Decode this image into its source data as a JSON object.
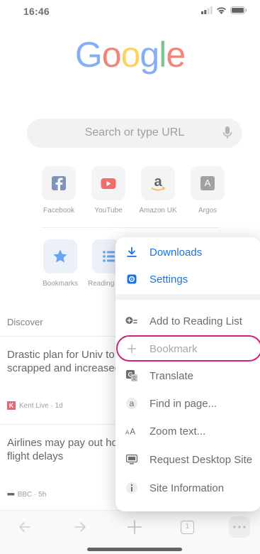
{
  "status": {
    "time": "16:46"
  },
  "logo": {
    "letters": [
      "G",
      "o",
      "o",
      "g",
      "l",
      "e"
    ],
    "colors": [
      "#4285F4",
      "#EA4335",
      "#FBBC05",
      "#4285F4",
      "#34A853",
      "#EA4335"
    ]
  },
  "search": {
    "placeholder": "Search or type URL"
  },
  "tiles_row1": [
    {
      "label": "Facebook",
      "icon": "facebook-icon"
    },
    {
      "label": "YouTube",
      "icon": "youtube-icon"
    },
    {
      "label": "Amazon UK",
      "icon": "amazon-icon"
    },
    {
      "label": "Argos",
      "icon": "argos-icon",
      "letter": "A"
    }
  ],
  "tiles_row2": [
    {
      "label": "Bookmarks",
      "icon": "star-icon"
    },
    {
      "label": "Reading",
      "icon": "list-icon"
    }
  ],
  "discover": {
    "heading": "Discover"
  },
  "articles": [
    {
      "title": "Drastic plan for Univ to be scrapped and increased",
      "source": "Kent Live · 1d",
      "source_badge": "K"
    },
    {
      "title": "Airlines may pay out hour UK flight delays",
      "source": "BBC · 5h",
      "source_badge": "■■■"
    }
  ],
  "menu": {
    "items": [
      {
        "label": "Downloads",
        "icon": "download-icon",
        "style": "blue"
      },
      {
        "label": "Settings",
        "icon": "gear-icon",
        "style": "blue"
      },
      {
        "label": "Add to Reading List",
        "icon": "add-reading-list-icon",
        "style": "gray"
      },
      {
        "label": "Bookmark",
        "icon": "plus-icon",
        "style": "faded"
      },
      {
        "label": "Translate",
        "icon": "translate-icon",
        "style": "gray"
      },
      {
        "label": "Find in page...",
        "icon": "find-icon",
        "style": "gray"
      },
      {
        "label": "Zoom text...",
        "icon": "zoom-text-icon",
        "style": "gray"
      },
      {
        "label": "Request Desktop Site",
        "icon": "desktop-icon",
        "style": "gray"
      },
      {
        "label": "Site Information",
        "icon": "info-icon",
        "style": "gray"
      }
    ]
  },
  "toolbar": {
    "tab_count": "1"
  },
  "colors": {
    "accent": "#1a73e8",
    "highlight": "#d4217a"
  }
}
